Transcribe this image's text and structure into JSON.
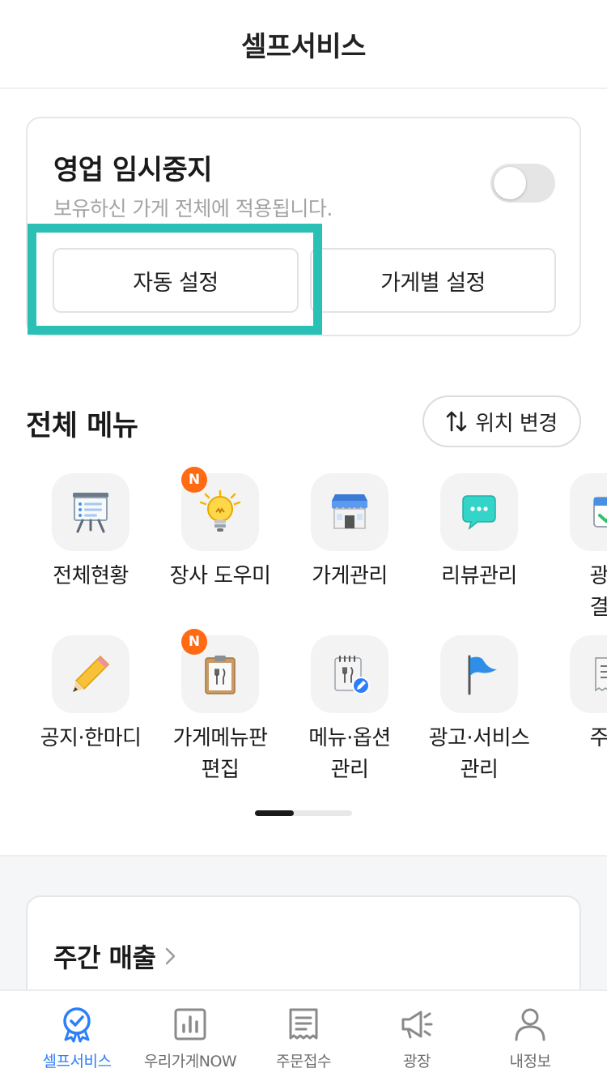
{
  "header": {
    "title": "셀프서비스"
  },
  "pause_card": {
    "title": "영업 임시중지",
    "description": "보유하신 가게 전체에 적용됩니다.",
    "toggle_on": false,
    "auto_setting_label": "자동 설정",
    "store_setting_label": "가게별 설정"
  },
  "menu": {
    "title": "전체 메뉴",
    "reorder_label": "위치 변경",
    "badge_text": "N",
    "items": [
      {
        "label": "전체현황",
        "icon": "presentation-board-icon",
        "badge": false
      },
      {
        "label": "장사 도우미",
        "icon": "lightbulb-icon",
        "badge": true
      },
      {
        "label": "가게관리",
        "icon": "storefront-icon",
        "badge": false
      },
      {
        "label": "리뷰관리",
        "icon": "chat-bubble-icon",
        "badge": false
      },
      {
        "label": "광고\n결제",
        "icon": "calendar-check-icon",
        "badge": false
      },
      {
        "label": "공지·한마디",
        "icon": "pencil-icon",
        "badge": false
      },
      {
        "label": "가게메뉴판\n편집",
        "icon": "clipboard-menu-icon",
        "badge": true
      },
      {
        "label": "메뉴·옵션\n관리",
        "icon": "menu-notepad-edit-icon",
        "badge": false
      },
      {
        "label": "광고·서비스\n관리",
        "icon": "flag-icon",
        "badge": false
      },
      {
        "label": "주문",
        "icon": "receipt-icon",
        "badge": false
      }
    ],
    "page_index": 1,
    "page_count": 2
  },
  "weekly_sales": {
    "title": "주간 매출"
  },
  "tabbar": {
    "active_color": "#2d7ff9",
    "tabs": [
      {
        "label": "셀프서비스",
        "icon": "badge-check-icon",
        "active": true
      },
      {
        "label": "우리가게NOW",
        "icon": "bar-chart-icon",
        "active": false
      },
      {
        "label": "주문접수",
        "icon": "receipt-icon",
        "active": false
      },
      {
        "label": "광장",
        "icon": "megaphone-icon",
        "active": false
      },
      {
        "label": "내정보",
        "icon": "person-icon",
        "active": false
      }
    ]
  },
  "colors": {
    "highlight": "#2bc0b5",
    "new_badge": "#ff6a13",
    "accent": "#2d7ff9"
  }
}
